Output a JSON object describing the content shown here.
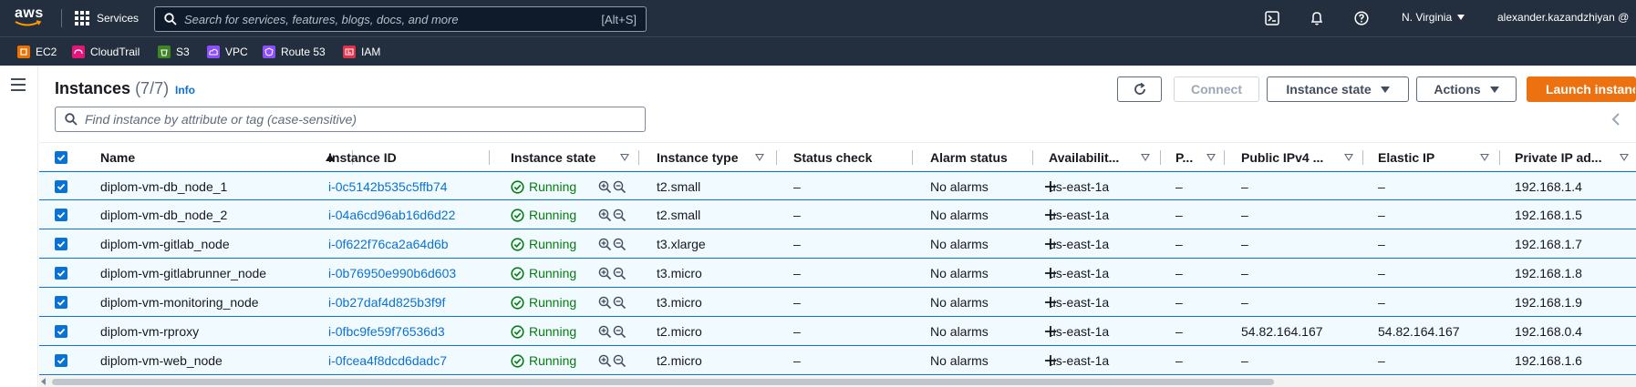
{
  "topnav": {
    "logo_text": "aws",
    "services_label": "Services",
    "search_placeholder": "Search for services, features, blogs, docs, and more",
    "search_shortcut": "[Alt+S]",
    "region": "N. Virginia",
    "account": "alexander.kazandzhiyan @"
  },
  "favorites": [
    {
      "label": "EC2",
      "color": "#ed7100"
    },
    {
      "label": "CloudTrail",
      "color": "#e7157b"
    },
    {
      "label": "S3",
      "color": "#3f8624"
    },
    {
      "label": "VPC",
      "color": "#8c4fff"
    },
    {
      "label": "Route 53",
      "color": "#8c4fff"
    },
    {
      "label": "IAM",
      "color": "#dd344c"
    }
  ],
  "header": {
    "title": "Instances",
    "count": "(7/7)",
    "info": "Info",
    "connect": "Connect",
    "instance_state": "Instance state",
    "actions": "Actions",
    "launch": "Launch instance"
  },
  "filter": {
    "placeholder": "Find instance by attribute or tag (case-sensitive)"
  },
  "table": {
    "columns": {
      "name": "Name",
      "instance_id": "Instance ID",
      "state": "Instance state",
      "type": "Instance type",
      "status_check": "Status check",
      "alarm": "Alarm status",
      "az": "Availabilit...",
      "p": "P...",
      "public_ip": "Public IPv4 ...",
      "elastic_ip": "Elastic IP",
      "private_ip": "Private IP ad..."
    },
    "rows": [
      {
        "name": "diplom-vm-db_node_1",
        "id": "i-0c5142b535c5ffb74",
        "state": "Running",
        "type": "t2.small",
        "status": "–",
        "alarm": "No alarms",
        "az": "us-east-1a",
        "p": "–",
        "public_ip": "–",
        "elastic_ip": "–",
        "private_ip": "192.168.1.4"
      },
      {
        "name": "diplom-vm-db_node_2",
        "id": "i-04a6cd96ab16d6d22",
        "state": "Running",
        "type": "t2.small",
        "status": "–",
        "alarm": "No alarms",
        "az": "us-east-1a",
        "p": "–",
        "public_ip": "–",
        "elastic_ip": "–",
        "private_ip": "192.168.1.5"
      },
      {
        "name": "diplom-vm-gitlab_node",
        "id": "i-0f622f76ca2a64d6b",
        "state": "Running",
        "type": "t3.xlarge",
        "status": "–",
        "alarm": "No alarms",
        "az": "us-east-1a",
        "p": "–",
        "public_ip": "–",
        "elastic_ip": "–",
        "private_ip": "192.168.1.7"
      },
      {
        "name": "diplom-vm-gitlabrunner_node",
        "id": "i-0b76950e990b6d603",
        "state": "Running",
        "type": "t3.micro",
        "status": "–",
        "alarm": "No alarms",
        "az": "us-east-1a",
        "p": "–",
        "public_ip": "–",
        "elastic_ip": "–",
        "private_ip": "192.168.1.8"
      },
      {
        "name": "diplom-vm-monitoring_node",
        "id": "i-0b27daf4d825b3f9f",
        "state": "Running",
        "type": "t3.micro",
        "status": "–",
        "alarm": "No alarms",
        "az": "us-east-1a",
        "p": "–",
        "public_ip": "–",
        "elastic_ip": "–",
        "private_ip": "192.168.1.9"
      },
      {
        "name": "diplom-vm-rproxy",
        "id": "i-0fbc9fe59f76536d3",
        "state": "Running",
        "type": "t2.micro",
        "status": "–",
        "alarm": "No alarms",
        "az": "us-east-1a",
        "p": "–",
        "public_ip": "54.82.164.167",
        "elastic_ip": "54.82.164.167",
        "private_ip": "192.168.0.4"
      },
      {
        "name": "diplom-vm-web_node",
        "id": "i-0fcea4f8dcd6dadc7",
        "state": "Running",
        "type": "t2.micro",
        "status": "–",
        "alarm": "No alarms",
        "az": "us-east-1a",
        "p": "–",
        "public_ip": "–",
        "elastic_ip": "–",
        "private_ip": "192.168.1.6"
      }
    ]
  },
  "colors": {
    "nav_bg": "#232f3e",
    "link": "#0972d3",
    "running": "#037f0c",
    "launch": "#ec7211",
    "row_selected_bg": "#f1faff"
  }
}
